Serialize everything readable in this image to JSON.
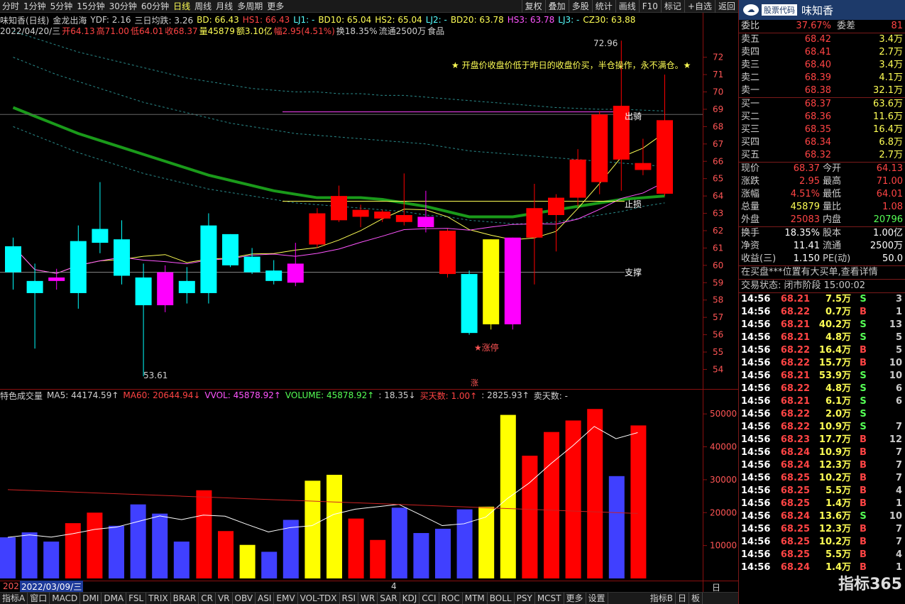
{
  "toolbar": {
    "periods": [
      "分时",
      "1分钟",
      "5分钟",
      "15分钟",
      "30分钟",
      "60分钟",
      "日线",
      "周线",
      "月线",
      "多周期",
      "更多"
    ],
    "active_period": "日线",
    "right_items": [
      "复权",
      "叠加",
      "多股",
      "统计",
      "画线",
      "F10",
      "标记",
      "+自选",
      "返回"
    ]
  },
  "legend": [
    {
      "text": "味知香(日线)",
      "color": "#d0d0d0"
    },
    {
      "text": "金龙出海",
      "color": "#d0d0d0"
    },
    {
      "text": "YDF: 2.16",
      "color": "#d0d0d0"
    },
    {
      "text": "三日均跌: 3.26",
      "color": "#d0d0d0"
    },
    {
      "text": "BD: 66.43",
      "color": "#ffff55"
    },
    {
      "text": "HS1: 66.43",
      "color": "#ff4444"
    },
    {
      "text": "LJ1: -",
      "color": "#55ffff"
    },
    {
      "text": "BD10: 65.04",
      "color": "#ffff55"
    },
    {
      "text": "HS2: 65.04",
      "color": "#ffff55"
    },
    {
      "text": "LJ2: -",
      "color": "#55ffff"
    },
    {
      "text": "BD20: 63.78",
      "color": "#ffff55"
    },
    {
      "text": "HS3: 63.78",
      "color": "#ff55ff"
    },
    {
      "text": "LJ3: -",
      "color": "#55ffff"
    },
    {
      "text": "CZ30: 63.88",
      "color": "#ffff55"
    }
  ],
  "info": [
    {
      "text": "2022/04/20/三",
      "color": "#d0d0d0"
    },
    {
      "text": "开64.13",
      "color": "#ff4444"
    },
    {
      "text": "高71.00",
      "color": "#ff4444"
    },
    {
      "text": "低64.01",
      "color": "#ff4444"
    },
    {
      "text": "收68.37",
      "color": "#ff4444"
    },
    {
      "text": "量45879",
      "color": "#ffff55"
    },
    {
      "text": "额3.10亿",
      "color": "#ffff55"
    },
    {
      "text": "幅2.95(4.51%)",
      "color": "#ff4444"
    },
    {
      "text": "换18.35%",
      "color": "#d0d0d0"
    },
    {
      "text": "流通2500万",
      "color": "#d0d0d0"
    },
    {
      "text": "食品",
      "color": "#d0d0d0"
    }
  ],
  "annotations": {
    "note": "★ 开盘价收盘价低于昨日的收盘价买，半仓操作，永不满仓。★",
    "high_label": "72.96",
    "low_label": "53.61",
    "zhangting": "★涨停",
    "zhang": "涨",
    "dapan": "出骑",
    "zhisun": "止损",
    "zhicheng": "支撑"
  },
  "colors": {
    "up": "#ff0000",
    "down": "#00ffff",
    "magenta": "#ff00ff",
    "yellow": "#ffff00",
    "green": "#1a9a1a",
    "vol_down": "#4040ff"
  },
  "price_axis": {
    "ticks": [
      72,
      71,
      70,
      69,
      68,
      67,
      66,
      65,
      64,
      63,
      62,
      61,
      60,
      59,
      58,
      57,
      56,
      55,
      54
    ]
  },
  "volume_axis": {
    "ticks": [
      50000,
      40000,
      30000,
      20000,
      10000
    ]
  },
  "chart_data": {
    "type": "candlestick",
    "y_range": [
      53.2,
      73.5
    ],
    "candles": [
      {
        "o": 59.6,
        "c": 61.1,
        "h": 61.6,
        "l": 58.6,
        "t": "down"
      },
      {
        "o": 59.1,
        "c": 58.4,
        "h": 60.1,
        "l": 55.2,
        "t": "down"
      },
      {
        "o": 59.3,
        "c": 59.1,
        "h": 59.8,
        "l": 58.6,
        "t": "mag"
      },
      {
        "o": 58.4,
        "c": 61.4,
        "h": 62.3,
        "l": 57.5,
        "t": "down"
      },
      {
        "o": 62.1,
        "c": 61.3,
        "h": 64.8,
        "l": 60.7,
        "t": "down"
      },
      {
        "o": 59.4,
        "c": 61.5,
        "h": 62.6,
        "l": 58.9,
        "t": "down"
      },
      {
        "o": 57.7,
        "c": 59.3,
        "h": 60.1,
        "l": 53.6,
        "t": "down"
      },
      {
        "o": 57.7,
        "c": 59.6,
        "h": 60.0,
        "l": 57.3,
        "t": "mag"
      },
      {
        "o": 58.4,
        "c": 59.1,
        "h": 59.9,
        "l": 57.8,
        "t": "down"
      },
      {
        "o": 58.4,
        "c": 62.3,
        "h": 63.0,
        "l": 57.8,
        "t": "down"
      },
      {
        "o": 60.0,
        "c": 61.8,
        "h": 61.8,
        "l": 59.9,
        "t": "down"
      },
      {
        "o": 59.6,
        "c": 60.5,
        "h": 61.0,
        "l": 59.5,
        "t": "down"
      },
      {
        "o": 59.1,
        "c": 59.7,
        "h": 60.3,
        "l": 58.9,
        "t": "down"
      },
      {
        "o": 59.0,
        "c": 60.1,
        "h": 61.3,
        "l": 58.8,
        "t": "mag"
      },
      {
        "o": 61.2,
        "c": 63.0,
        "h": 63.3,
        "l": 61.0,
        "t": "up"
      },
      {
        "o": 62.6,
        "c": 64.0,
        "h": 64.6,
        "l": 62.5,
        "t": "up"
      },
      {
        "o": 62.8,
        "c": 63.2,
        "h": 63.5,
        "l": 62.2,
        "t": "up"
      },
      {
        "o": 62.7,
        "c": 63.1,
        "h": 63.2,
        "l": 62.5,
        "t": "up"
      },
      {
        "o": 62.5,
        "c": 62.9,
        "h": 65.3,
        "l": 62.3,
        "t": "up"
      },
      {
        "o": 62.2,
        "c": 62.8,
        "h": 64.3,
        "l": 61.9,
        "t": "mag"
      },
      {
        "o": 59.5,
        "c": 62.0,
        "h": 62.1,
        "l": 59.3,
        "t": "up"
      },
      {
        "o": 56.1,
        "c": 59.5,
        "h": 59.7,
        "l": 56.0,
        "t": "down"
      },
      {
        "o": 56.6,
        "c": 61.5,
        "h": 61.5,
        "l": 56.3,
        "t": "yel"
      },
      {
        "o": 56.6,
        "c": 61.6,
        "h": 61.6,
        "l": 56.3,
        "t": "mag"
      },
      {
        "o": 61.6,
        "c": 63.3,
        "h": 64.7,
        "l": 58.9,
        "t": "up"
      },
      {
        "o": 62.9,
        "c": 63.9,
        "h": 64.1,
        "l": 60.8,
        "t": "up"
      },
      {
        "o": 63.9,
        "c": 66.1,
        "h": 66.7,
        "l": 63.4,
        "t": "up"
      },
      {
        "o": 64.8,
        "c": 68.7,
        "h": 68.9,
        "l": 64.1,
        "t": "up"
      },
      {
        "o": 66.1,
        "c": 69.2,
        "h": 72.96,
        "l": 64.3,
        "t": "up"
      },
      {
        "o": 65.5,
        "c": 65.9,
        "h": 67.3,
        "l": 65.2,
        "t": "up"
      },
      {
        "o": 64.13,
        "c": 68.37,
        "h": 71.0,
        "l": 64.01,
        "t": "up"
      }
    ],
    "volume": {
      "values": [
        12500,
        14000,
        11200,
        16800,
        20000,
        16000,
        22500,
        19700,
        11200,
        26800,
        14400,
        10200,
        8100,
        17800,
        29700,
        31500,
        18200,
        11700,
        21500,
        13800,
        15100,
        21000,
        21800,
        49700,
        37300,
        44500,
        48000,
        51500,
        31100,
        46500
      ],
      "colors": [
        "b",
        "b",
        "b",
        "r",
        "r",
        "b",
        "b",
        "b",
        "b",
        "r",
        "r",
        "y",
        "b",
        "b",
        "y",
        "y",
        "r",
        "r",
        "b",
        "b",
        "b",
        "b",
        "y",
        "y",
        "r",
        "r",
        "r",
        "r",
        "b",
        "r"
      ]
    }
  },
  "volume_legend": [
    {
      "text": "特色成交量",
      "color": "#d0d0d0"
    },
    {
      "text": "MA5: 44174.59↑",
      "color": "#d0d0d0"
    },
    {
      "text": "MA60: 20644.94↓",
      "color": "#ff4444"
    },
    {
      "text": "VVOL: 45878.92↑",
      "color": "#ff55ff"
    },
    {
      "text": "VOLUME: 45878.92↑",
      "color": "#55ff55"
    },
    {
      "text": ": 18.35↓",
      "color": "#d0d0d0"
    },
    {
      "text": "买天数: 1.00↑",
      "color": "#ff4444"
    },
    {
      "text": ": 2825.93↑",
      "color": "#d0d0d0"
    },
    {
      "text": "卖天数: -",
      "color": "#d0d0d0"
    }
  ],
  "date_label": "2022/03/09/三",
  "date_prefix": "202",
  "date_mark": "4",
  "bottom_tabs": [
    "指标A",
    "窗口",
    "MACD",
    "DMI",
    "DMA",
    "FSL",
    "TRIX",
    "BRAR",
    "CR",
    "VR",
    "OBV",
    "ASI",
    "EMV",
    "VOL-TDX",
    "RSI",
    "WR",
    "SAR",
    "KDJ",
    "CCI",
    "ROC",
    "MTM",
    "BOLL",
    "PSY",
    "MCST",
    "更多",
    "设置"
  ],
  "bottom_right": [
    "指标B",
    "日",
    "板"
  ],
  "daily_label": "日线",
  "panel": {
    "code": "股票代码",
    "name": "味知香",
    "weibi": {
      "l1": "委比",
      "v1": "37.67%",
      "l2": "委差",
      "v2": "81"
    },
    "asks": [
      {
        "l": "卖五",
        "p": "68.42",
        "v": "3.4万"
      },
      {
        "l": "卖四",
        "p": "68.41",
        "v": "2.7万"
      },
      {
        "l": "卖三",
        "p": "68.40",
        "v": "3.4万"
      },
      {
        "l": "卖二",
        "p": "68.39",
        "v": "4.1万"
      },
      {
        "l": "卖一",
        "p": "68.38",
        "v": "32.1万"
      }
    ],
    "bids": [
      {
        "l": "买一",
        "p": "68.37",
        "v": "63.6万"
      },
      {
        "l": "买二",
        "p": "68.36",
        "v": "11.6万"
      },
      {
        "l": "买三",
        "p": "68.35",
        "v": "16.4万"
      },
      {
        "l": "买四",
        "p": "68.34",
        "v": "6.8万"
      },
      {
        "l": "买五",
        "p": "68.32",
        "v": "2.7万"
      }
    ],
    "quote": [
      {
        "l1": "现价",
        "v1": "68.37",
        "l2": "今开",
        "v2": "64.13"
      },
      {
        "l1": "涨跌",
        "v1": "2.95",
        "l2": "最高",
        "v2": "71.00"
      },
      {
        "l1": "涨幅",
        "v1": "4.51%",
        "l2": "最低",
        "v2": "64.01"
      },
      {
        "l1": "总量",
        "v1": "45879",
        "l2": "量比",
        "v2": "1.08"
      },
      {
        "l1": "外盘",
        "v1": "25083",
        "l2": "内盘",
        "v2": "20796"
      }
    ],
    "fund": [
      {
        "l1": "换手",
        "v1": "18.35%",
        "l2": "股本",
        "v2": "1.00亿"
      },
      {
        "l1": "净资",
        "v1": "11.41",
        "l2": "流通",
        "v2": "2500万"
      },
      {
        "l1": "收益(三)",
        "v1": "1.150",
        "l2": "PE(动)",
        "v2": "50.0"
      }
    ],
    "notice": "在买盘***位置有大买单,查看详情",
    "status": "交易状态: 闭市阶段 15:00:02",
    "ticks": [
      {
        "t": "14:56",
        "p": "68.21",
        "v": "7.5万",
        "d": "S",
        "n": "3"
      },
      {
        "t": "14:56",
        "p": "68.22",
        "v": "0.7万",
        "d": "B",
        "n": "1"
      },
      {
        "t": "14:56",
        "p": "68.21",
        "v": "40.2万",
        "d": "S",
        "n": "13"
      },
      {
        "t": "14:56",
        "p": "68.21",
        "v": "4.8万",
        "d": "S",
        "n": "5"
      },
      {
        "t": "14:56",
        "p": "68.22",
        "v": "16.4万",
        "d": "B",
        "n": "5"
      },
      {
        "t": "14:56",
        "p": "68.22",
        "v": "15.7万",
        "d": "B",
        "n": "10"
      },
      {
        "t": "14:56",
        "p": "68.21",
        "v": "53.9万",
        "d": "S",
        "n": "10"
      },
      {
        "t": "14:56",
        "p": "68.22",
        "v": "4.8万",
        "d": "S",
        "n": "6"
      },
      {
        "t": "14:56",
        "p": "68.21",
        "v": "6.1万",
        "d": "S",
        "n": "6"
      },
      {
        "t": "14:56",
        "p": "68.22",
        "v": "2.0万",
        "d": "S",
        "n": ""
      },
      {
        "t": "14:56",
        "p": "68.22",
        "v": "10.9万",
        "d": "S",
        "n": "7"
      },
      {
        "t": "14:56",
        "p": "68.23",
        "v": "17.7万",
        "d": "B",
        "n": "12"
      },
      {
        "t": "14:56",
        "p": "68.24",
        "v": "10.9万",
        "d": "B",
        "n": "7"
      },
      {
        "t": "14:56",
        "p": "68.24",
        "v": "12.3万",
        "d": "B",
        "n": "7"
      },
      {
        "t": "14:56",
        "p": "68.25",
        "v": "10.2万",
        "d": "B",
        "n": "7"
      },
      {
        "t": "14:56",
        "p": "68.25",
        "v": "5.5万",
        "d": "B",
        "n": "4"
      },
      {
        "t": "14:56",
        "p": "68.25",
        "v": "1.4万",
        "d": "B",
        "n": "1"
      },
      {
        "t": "14:56",
        "p": "68.24",
        "v": "13.6万",
        "d": "S",
        "n": "10"
      },
      {
        "t": "14:56",
        "p": "68.25",
        "v": "12.3万",
        "d": "B",
        "n": "7"
      },
      {
        "t": "14:56",
        "p": "68.25",
        "v": "10.2万",
        "d": "B",
        "n": "7"
      },
      {
        "t": "14:56",
        "p": "68.25",
        "v": "5.5万",
        "d": "B",
        "n": "4"
      },
      {
        "t": "14:56",
        "p": "68.24",
        "v": "1.4万",
        "d": "B",
        "n": "1"
      }
    ],
    "watermark": "指标365"
  }
}
